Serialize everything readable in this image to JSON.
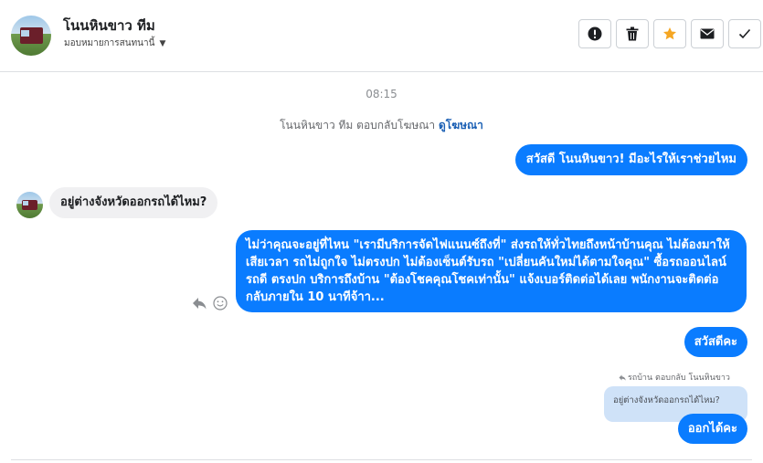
{
  "header": {
    "contact_name": "โนนหินขาว ทีม",
    "assign_label": "มอบหมายการสนทนานี้",
    "actions": [
      {
        "name": "report",
        "icon": "exclamation-circle-icon"
      },
      {
        "name": "delete",
        "icon": "trash-icon"
      },
      {
        "name": "star",
        "icon": "star-icon",
        "color": "#f5a623"
      },
      {
        "name": "mark-unread",
        "icon": "envelope-icon"
      },
      {
        "name": "done",
        "icon": "checkmark-icon"
      }
    ]
  },
  "conversation": {
    "timestamp": "08:15",
    "ad_reply_text": "โนนหินขาว ทีม ตอบกลับโฆษณา",
    "ad_link": "ดูโฆษณา",
    "messages": [
      {
        "direction": "outgoing",
        "text": "สวัสดี โนนหินขาว! มีอะไรให้เราช่วยไหม"
      },
      {
        "direction": "incoming",
        "text": "อยู่ต่างจังหวัดออกรถได้ไหม?"
      },
      {
        "direction": "outgoing",
        "text": "ไม่ว่าคุณจะอยู่ที่ไหน \"เรามีบริการจัดไฟแนนซ์ถึงที่\"  ส่งรถให้ทั่วไทยถึงหน้าบ้านคุณ ไม่ต้องมาให้เสียเวลา รถไม่ถูกใจ ไม่ตรงปก ไม่ต้องเซ็นต์รับรถ \"เปลี่ยนคันใหม่ได้ตามใจคุณ\" ซื้อรถออนไลน์ รถดี ตรงปก บริการถึงบ้าน \"ต้องโชคคุณโชคเท่านั้น\" แจ้งเบอร์ติดต่อได้เลย พนักงานจะติดต่อกลับภายใน 10 นาทีจ้าา..."
      },
      {
        "direction": "outgoing",
        "text": "สวัสดีคะ"
      },
      {
        "direction": "outgoing",
        "text": "ออกได้คะ"
      }
    ],
    "reply_meta": "รถบ้าน ตอบกลับ โนนหินขาว",
    "quoted_text": "อยู่ต่างจังหวัดออกรถได้ไหม?"
  },
  "colors": {
    "outgoing_bubble": "#0a7cff",
    "incoming_bubble": "#f0f0f2",
    "quoted_bubble": "#cfe2f8",
    "link": "#1a5fb4",
    "star": "#f5a623"
  }
}
